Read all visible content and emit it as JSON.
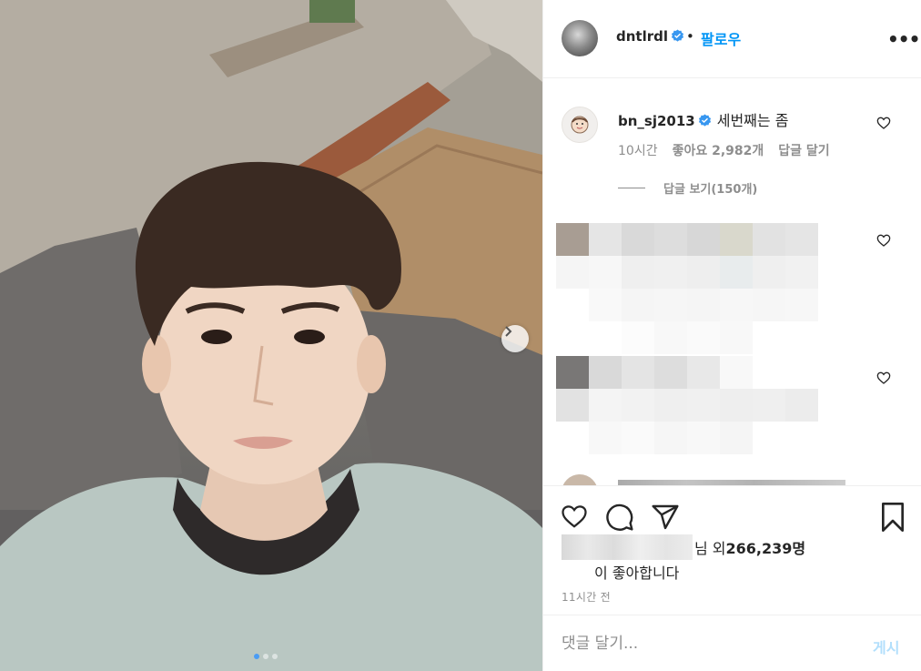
{
  "header": {
    "username": "dntlrdl",
    "separator": "•",
    "follow_label": "팔로우",
    "more_label": "•••"
  },
  "first_comment": {
    "username": "bn_sj2013",
    "text": "세번째는 좀",
    "time": "10시간",
    "likes": "좋아요 2,982개",
    "reply_label": "답글 달기",
    "view_replies": "답글 보기(150개)"
  },
  "likes": {
    "suffix": "님 외 ",
    "count": "266,239명",
    "liked_text": "이 좋아합니다"
  },
  "post_time": "11시간 전",
  "composer": {
    "placeholder": "댓글 달기...",
    "post_label": "게시"
  },
  "carousel": {
    "slide_count": 3,
    "active_slide": 1
  },
  "colors": {
    "accent": "#0095f6",
    "verified": "#3897f0",
    "post_disabled": "#b2dffc",
    "muted": "#8e8e8e"
  },
  "icons": [
    "verified-icon",
    "more-icon",
    "heart-icon",
    "comment-icon",
    "share-icon",
    "bookmark-icon",
    "chevron-right-icon"
  ]
}
